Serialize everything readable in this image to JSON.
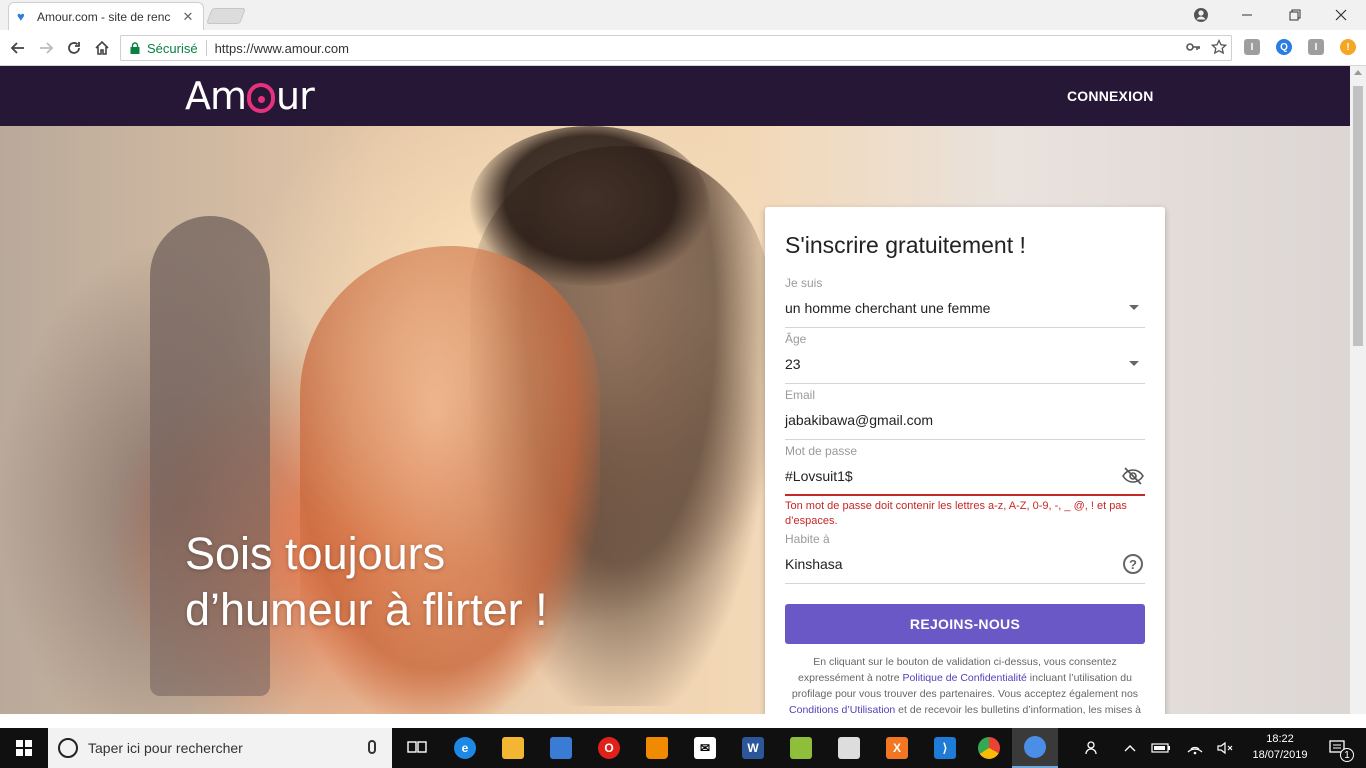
{
  "browser": {
    "tab_title": "Amour.com - site de renc",
    "secure_label": "Sécurisé",
    "url": "https://www.amour.com"
  },
  "site": {
    "logo": {
      "before": "Am",
      "after": "ur"
    },
    "nav_login": "CONNEXION",
    "headline_line1": "Sois toujours",
    "headline_line2": "d’humeur à flirter !"
  },
  "form": {
    "title": "S'inscrire gratuitement !",
    "fields": {
      "je_suis": {
        "label": "Je suis",
        "value": "un homme cherchant une femme"
      },
      "age": {
        "label": "Âge",
        "value": "23"
      },
      "email": {
        "label": "Email",
        "value": "jabakibawa@gmail.com"
      },
      "password": {
        "label": "Mot de passe",
        "value": "#Lovsuit1$"
      },
      "city": {
        "label": "Habite à",
        "value": "Kinshasa"
      }
    },
    "password_error": "Ton mot de passe doit contenir les lettres a-z, A-Z, 0-9, -, _ @, ! et pas d’espaces.",
    "submit": "REJOINS-NOUS",
    "legal": {
      "part1": "En cliquant sur le bouton de validation ci-dessus, vous consentez expressément à notre ",
      "privacy_link": "Politique de Confidentialité",
      "part2": " incluant l’utilisation du profilage pour vous trouver des partenaires. Vous acceptez également nos ",
      "terms_link": "Conditions d’Utilisation",
      "part3": " et de recevoir les bulletins d’information, les mises à jour de compte et les offres envoyées par Amour."
    }
  },
  "taskbar": {
    "search_placeholder": "Taper ici pour rechercher",
    "time": "18:22",
    "date": "18/07/2019",
    "notification_count": "1"
  },
  "colors": {
    "site_header": "#261737",
    "accent": "#6b58c7",
    "logo_pink": "#e8317c",
    "error": "#c62828",
    "secure_green": "#0b8043"
  }
}
